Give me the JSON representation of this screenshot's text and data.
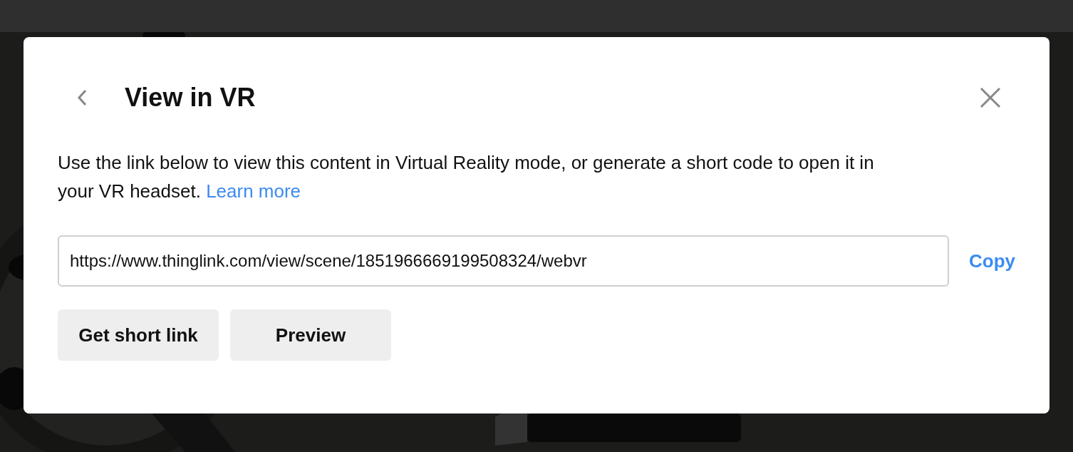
{
  "dialog": {
    "title": "View in VR",
    "description": "Use the link below to view this content in Virtual Reality mode, or generate a short code to open it in your VR headset.",
    "learn_more": "Learn more",
    "link_field": {
      "value": "https://www.thinglink.com/view/scene/1851966669199508324/webvr"
    },
    "copy": "Copy",
    "buttons": [
      "Get short link",
      "Preview"
    ]
  }
}
